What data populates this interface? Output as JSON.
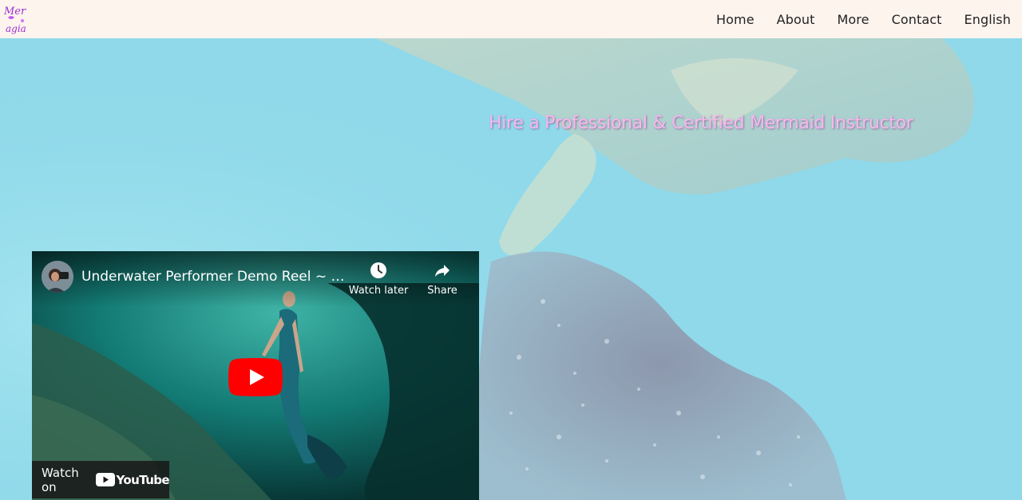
{
  "nav": {
    "logo_text": "Mer agia",
    "links": [
      "Home",
      "About",
      "More",
      "Contact",
      "English"
    ]
  },
  "hero": {
    "title": "Hire a Professional & Certified Mermaid Instructor"
  },
  "video": {
    "title": "Underwater Performer Demo Reel ~ Su...",
    "watch_later": "Watch later",
    "share": "Share",
    "watch_on": "Watch on",
    "youtube_word": "YouTube"
  },
  "colors": {
    "nav_bg": "#fdf4ee",
    "hero_title": "#f7b8ee",
    "youtube_red": "#ff0000",
    "water": "#8fd9ea"
  },
  "icons": [
    "logo-icon",
    "clock-icon",
    "share-arrow-icon",
    "play-icon",
    "youtube-logo-icon"
  ]
}
